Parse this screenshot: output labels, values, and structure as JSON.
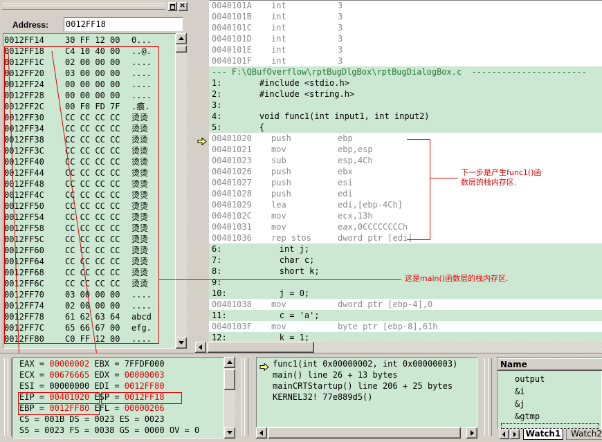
{
  "memory": {
    "address_label": "Address:",
    "address_value": "0012FF18",
    "rows": [
      {
        "addr": "0012FF14",
        "bytes": "30 FF 12 00",
        "ascii": "0..."
      },
      {
        "addr": "0012FF18",
        "bytes": "C4 10 40 00",
        "ascii": "..@."
      },
      {
        "addr": "0012FF1C",
        "bytes": "02 00 00 00",
        "ascii": "...."
      },
      {
        "addr": "0012FF20",
        "bytes": "03 00 00 00",
        "ascii": "...."
      },
      {
        "addr": "0012FF24",
        "bytes": "00 00 00 00",
        "ascii": "...."
      },
      {
        "addr": "0012FF28",
        "bytes": "00 00 00 00",
        "ascii": "...."
      },
      {
        "addr": "0012FF2C",
        "bytes": "00 F0 FD 7F",
        "ascii": ".痕."
      },
      {
        "addr": "0012FF30",
        "bytes": "CC CC CC CC",
        "ascii": "烫烫"
      },
      {
        "addr": "0012FF34",
        "bytes": "CC CC CC CC",
        "ascii": "烫烫"
      },
      {
        "addr": "0012FF38",
        "bytes": "CC CC CC CC",
        "ascii": "烫烫"
      },
      {
        "addr": "0012FF3C",
        "bytes": "CC CC CC CC",
        "ascii": "烫烫"
      },
      {
        "addr": "0012FF40",
        "bytes": "CC CC CC CC",
        "ascii": "烫烫"
      },
      {
        "addr": "0012FF44",
        "bytes": "CC CC CC CC",
        "ascii": "烫烫"
      },
      {
        "addr": "0012FF48",
        "bytes": "CC CC CC CC",
        "ascii": "烫烫"
      },
      {
        "addr": "0012FF4C",
        "bytes": "CC CC CC CC",
        "ascii": "烫烫"
      },
      {
        "addr": "0012FF50",
        "bytes": "CC CC CC CC",
        "ascii": "烫烫"
      },
      {
        "addr": "0012FF54",
        "bytes": "CC CC CC CC",
        "ascii": "烫烫"
      },
      {
        "addr": "0012FF58",
        "bytes": "CC CC CC CC",
        "ascii": "烫烫"
      },
      {
        "addr": "0012FF5C",
        "bytes": "CC CC CC CC",
        "ascii": "烫烫"
      },
      {
        "addr": "0012FF60",
        "bytes": "CC CC CC CC",
        "ascii": "烫烫"
      },
      {
        "addr": "0012FF64",
        "bytes": "CC CC CC CC",
        "ascii": "烫烫"
      },
      {
        "addr": "0012FF68",
        "bytes": "CC CC CC CC",
        "ascii": "烫烫"
      },
      {
        "addr": "0012FF6C",
        "bytes": "CC CC CC CC",
        "ascii": "烫烫"
      },
      {
        "addr": "0012FF70",
        "bytes": "03 00 00 00",
        "ascii": "...."
      },
      {
        "addr": "0012FF74",
        "bytes": "02 00 00 00",
        "ascii": "...."
      },
      {
        "addr": "0012FF78",
        "bytes": "61 62 63 64",
        "ascii": "abcd"
      },
      {
        "addr": "0012FF7C",
        "bytes": "65 66 67 00",
        "ascii": "efg."
      },
      {
        "addr": "0012FF80",
        "bytes": "C0 FF 12 00",
        "ascii": "...."
      }
    ]
  },
  "disassembly": {
    "rows": [
      {
        "type": "asm",
        "addr": "0040101A",
        "mn": "int",
        "op": "3"
      },
      {
        "type": "asm",
        "addr": "0040101B",
        "mn": "int",
        "op": "3"
      },
      {
        "type": "asm",
        "addr": "0040101C",
        "mn": "int",
        "op": "3"
      },
      {
        "type": "asm",
        "addr": "0040101D",
        "mn": "int",
        "op": "3"
      },
      {
        "type": "asm",
        "addr": "0040101E",
        "mn": "int",
        "op": "3"
      },
      {
        "type": "asm",
        "addr": "0040101F",
        "mn": "int",
        "op": "3"
      },
      {
        "type": "file",
        "text": "--- F:\\QBufOverflow\\rptBugDlgBox\\rptBugDialogBox.c  -----------------------"
      },
      {
        "type": "src",
        "num": "1:",
        "text": "    #include <stdio.h>"
      },
      {
        "type": "src",
        "num": "2:",
        "text": "    #include <string.h>"
      },
      {
        "type": "src",
        "num": "3:",
        "text": ""
      },
      {
        "type": "src",
        "num": "4:",
        "text": "    void func1(int input1, int input2)"
      },
      {
        "type": "src",
        "num": "5:",
        "text": "    {"
      },
      {
        "type": "asmw",
        "addr": "00401020",
        "mn": "push",
        "op": "ebp",
        "current": true
      },
      {
        "type": "asmw",
        "addr": "00401021",
        "mn": "mov",
        "op": "ebp,esp"
      },
      {
        "type": "asmw",
        "addr": "00401023",
        "mn": "sub",
        "op": "esp,4Ch"
      },
      {
        "type": "asmw",
        "addr": "00401026",
        "mn": "push",
        "op": "ebx"
      },
      {
        "type": "asmw",
        "addr": "00401027",
        "mn": "push",
        "op": "esi"
      },
      {
        "type": "asmw",
        "addr": "00401028",
        "mn": "push",
        "op": "edi"
      },
      {
        "type": "asmw",
        "addr": "00401029",
        "mn": "lea",
        "op": "edi,[ebp-4Ch]"
      },
      {
        "type": "asmw",
        "addr": "0040102C",
        "mn": "mov",
        "op": "ecx,13h"
      },
      {
        "type": "asmw",
        "addr": "00401031",
        "mn": "mov",
        "op": "eax,0CCCCCCCCh"
      },
      {
        "type": "asmw",
        "addr": "00401036",
        "mn": "rep stos",
        "op": "dword ptr [edi]"
      },
      {
        "type": "src",
        "num": "6:",
        "text": "        int j;"
      },
      {
        "type": "src",
        "num": "7:",
        "text": "        char c;"
      },
      {
        "type": "src",
        "num": "8:",
        "text": "        short k;"
      },
      {
        "type": "src",
        "num": "9:",
        "text": ""
      },
      {
        "type": "src",
        "num": "10:",
        "text": "        j = 0;"
      },
      {
        "type": "asm",
        "addr": "00401038",
        "mn": "mov",
        "op": "dword ptr [ebp-4],0"
      },
      {
        "type": "src",
        "num": "11:",
        "text": "        c = 'a';"
      },
      {
        "type": "asm",
        "addr": "0040103F",
        "mn": "mov",
        "op": "byte ptr [ebp-8],61h"
      },
      {
        "type": "src",
        "num": "12:",
        "text": "        k = 1;"
      }
    ]
  },
  "annotations": {
    "func1_note_line1": "下一步是产生func1()函",
    "func1_note_line2": "数层的栈内存区.",
    "main_note": "这是main()函数层的栈内存区."
  },
  "registers": {
    "rows": [
      [
        {
          "name": "EAX",
          "value": "00000002",
          "changed": true
        },
        {
          "name": "EBX",
          "value": "7FFDF000",
          "changed": false
        }
      ],
      [
        {
          "name": "ECX",
          "value": "00676665",
          "changed": true
        },
        {
          "name": "EDX",
          "value": "00000003",
          "changed": true
        }
      ],
      [
        {
          "name": "ESI",
          "value": "00000000",
          "changed": false
        },
        {
          "name": "EDI",
          "value": "0012FF80",
          "changed": true
        }
      ],
      [
        {
          "name": "EIP",
          "value": "00401020",
          "changed": true
        },
        {
          "name": "ESP",
          "value": "0012FF18",
          "changed": true
        }
      ],
      [
        {
          "name": "EBP",
          "value": "0012FF80",
          "changed": true
        },
        {
          "name": "EFL",
          "value": "00000206",
          "changed": true
        }
      ],
      [
        {
          "name": "CS",
          "value": "001B",
          "changed": false
        },
        {
          "name": "DS",
          "value": "0023",
          "changed": false
        },
        {
          "name": "ES",
          "value": "0023",
          "changed": false
        }
      ],
      [
        {
          "name": "SS",
          "value": "0023",
          "changed": false
        },
        {
          "name": "FS",
          "value": "0038",
          "changed": false
        },
        {
          "name": "GS",
          "value": "0000",
          "changed": false
        },
        {
          "name": "OV",
          "value": "0",
          "changed": false
        }
      ]
    ]
  },
  "callstack": {
    "rows": [
      "func1(int 0x00000002, int 0x00000003)",
      "main() line 26 + 13 bytes",
      "mainCRTStartup() line 206 + 25 bytes",
      "KERNEL32! 77e889d5()"
    ]
  },
  "watch": {
    "header": "Name",
    "items": [
      "output",
      "&i",
      "&j",
      "&gtmp"
    ],
    "tabs": [
      "Watch1",
      "Watch2"
    ]
  },
  "colors": {
    "pane_green": "#cde8d2",
    "changed_red": "#e00000",
    "address_gray": "#8a8a8a"
  }
}
